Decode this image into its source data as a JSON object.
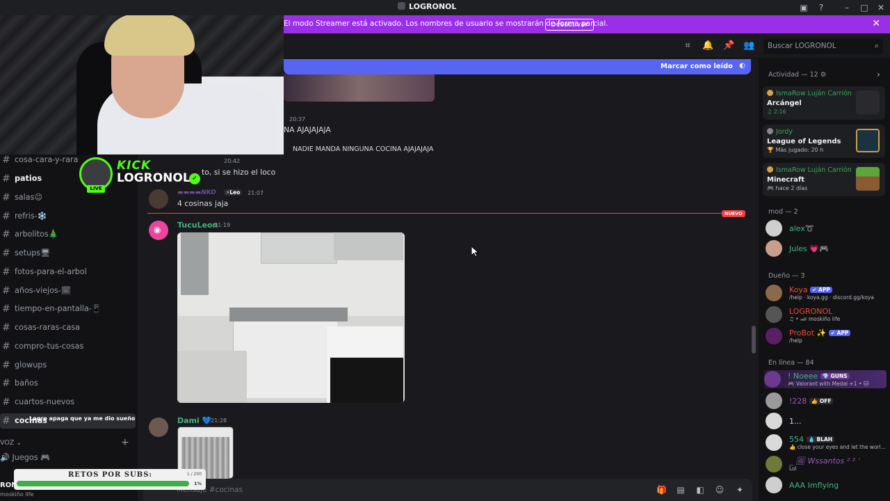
{
  "window": {
    "title": "LOGRONOL"
  },
  "banner": {
    "text": "El modo Streamer está activado. Los nombres de usuario se mostrarán de forma parcial.",
    "button": "Desactivar"
  },
  "search": {
    "placeholder": "Buscar LOGRONOL"
  },
  "sidebar": {
    "channels": [
      {
        "name": "cosa-cara-y-rara"
      },
      {
        "name": "patios"
      },
      {
        "name": "salas😉"
      },
      {
        "name": "refris-❄️"
      },
      {
        "name": "arbolitos🎄"
      },
      {
        "name": "setups🖥"
      },
      {
        "name": "fotos-para-el-arbol"
      },
      {
        "name": "años-viejos-🗓"
      },
      {
        "name": "tiempo-en-pantalla-📱"
      },
      {
        "name": "cosas-raras-casa"
      },
      {
        "name": "compro-tus-cosas"
      },
      {
        "name": "glowups"
      },
      {
        "name": "baños"
      },
      {
        "name": "cuartos-nuevos"
      },
      {
        "name": "cocinas"
      }
    ],
    "voice_category": "VOZ",
    "voice_channel": "🔊 Juegos 🎮",
    "user_name": "RON",
    "user_status": "moskiño life",
    "overlay_chat": "Logro apaga que ya me dio sueño"
  },
  "kick": {
    "brand": "KICK",
    "user": "LOGRONOL",
    "live": "LIVE"
  },
  "retos": {
    "label": "RETOS POR SUBS:",
    "count": "1 / 200",
    "percent": "1%",
    "progress": 0.01
  },
  "header": {
    "mark_read": "Marcar como leído"
  },
  "chat": {
    "m1_time": "20:37",
    "m1_text": "NA AJAJAJAJA",
    "m2_text": "NADIE MANDA NINGUNA COCINA AJAJAJAJA",
    "m3_time": "20:42",
    "m3_text": "to, si se hizo el loco",
    "m4_tag": "⚡Leo",
    "m4_time": "21:07",
    "m4_text": "4 cosinas jaja",
    "new_badge": "NUEVO",
    "m5_user": "TucuLeon",
    "m5_time": "21:19",
    "m6_user": "Dami 💙",
    "m6_time": "21:28"
  },
  "composer": {
    "placeholder": "Mensaje #cocinas"
  },
  "members": {
    "activity_header": "Actividad — 12 ⚙",
    "activities": [
      {
        "user": "IsmaRow Luján Carrión",
        "game": "Arcángel",
        "sub": "♫ 2:16"
      },
      {
        "user": "Jordy",
        "game": "League of Legends",
        "sub": "🏆 Más jugado: 20 h"
      },
      {
        "user": "IsmaRow Luján Carrión",
        "game": "Minecraft",
        "sub": "🎮 hace 2 días"
      }
    ],
    "mod_header": "mod — 2",
    "mods": [
      {
        "name": "alex",
        "suffix": "➰",
        "color": "#43b581"
      },
      {
        "name": "Jules",
        "suffix": "💗🎮",
        "color": "#43b581"
      }
    ],
    "owner_header": "Dueño — 3",
    "owners": [
      {
        "name": "Koya",
        "tag": "✔ APP",
        "status": "/help · koya.gg · discord.gg/koya",
        "color": "#e74c3c"
      },
      {
        "name": "LOGRONOL",
        "tag": "",
        "status": "♫ • 🏎 moskiño life",
        "color": "#e74c3c"
      },
      {
        "name": "ProBot ✨",
        "tag": "✔ APP",
        "status": "/help",
        "color": "#e74c3c"
      }
    ],
    "online_header": "En línea — 84",
    "online": [
      {
        "name": "! Noeee",
        "tag": "💎 GUNS",
        "status": "🎮 Valorant with Medal +1 • 🐱",
        "color": "#43b581"
      },
      {
        "name": "!228",
        "tag": "👍 OFF",
        "status": "",
        "color": "#9b59b6"
      },
      {
        "name": "1...",
        "tag": "",
        "status": "",
        "color": "#c9cdfb"
      },
      {
        "name": "554",
        "tag": "💧 BLAH",
        "status": "👍 close your eyes and let the worl...",
        "color": "#43b581"
      },
      {
        "name": "_ 🖼 Wssantos ² ² ʾ",
        "tag": "",
        "status": "Lol",
        "color": "#9b59b6"
      },
      {
        "name": "AAA Imflying",
        "tag": "",
        "status": "",
        "color": "#43b581"
      }
    ]
  }
}
